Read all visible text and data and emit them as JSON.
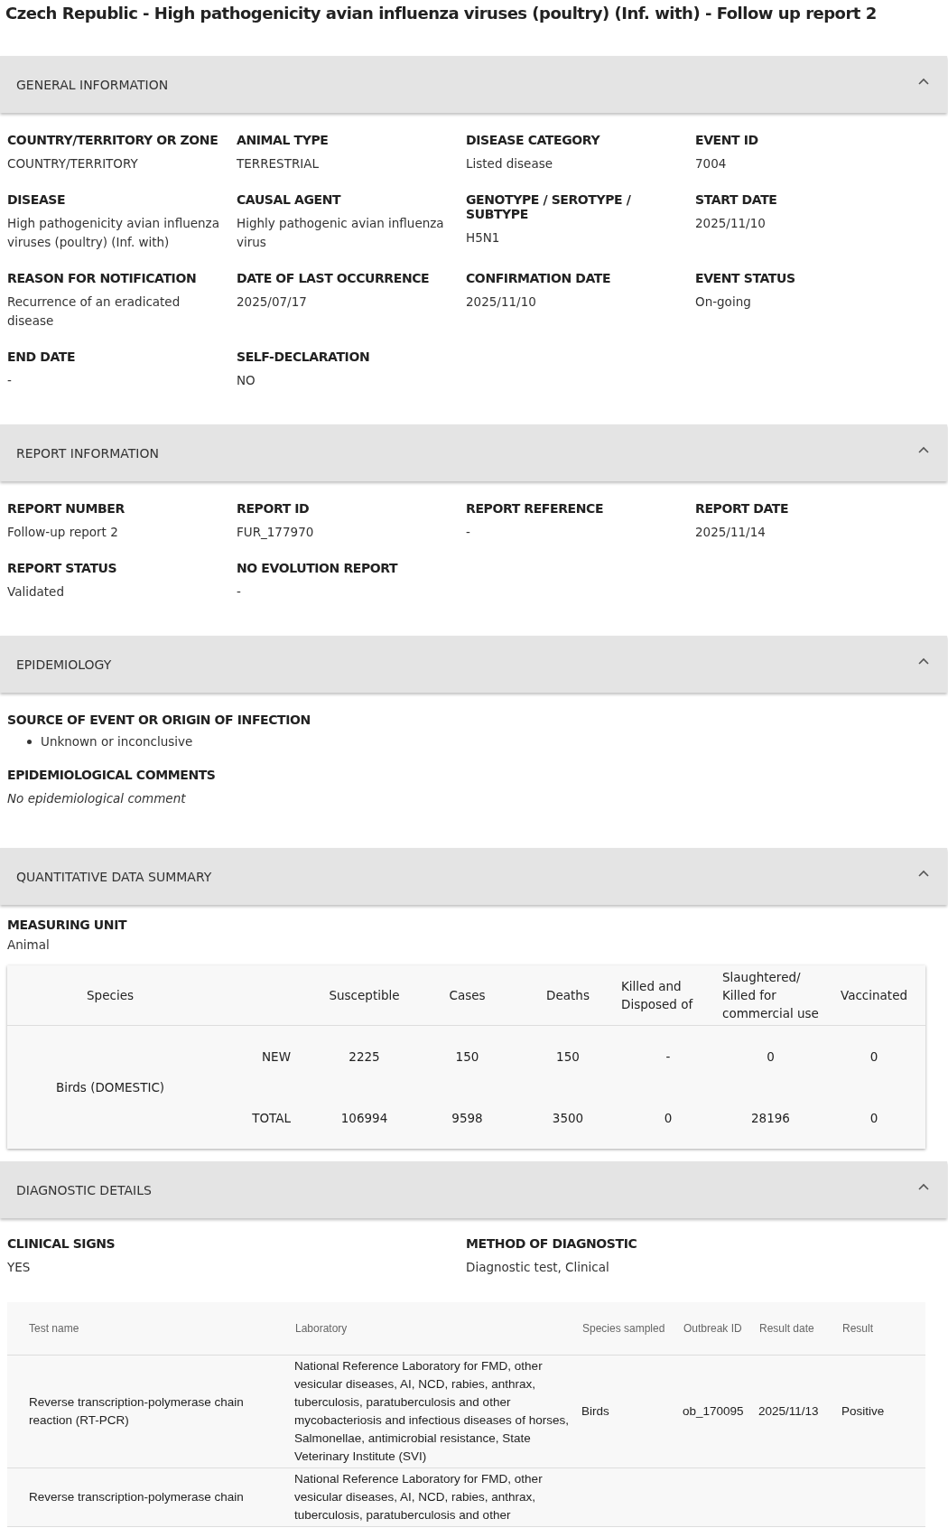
{
  "title": "Czech Republic - High pathogenicity avian influenza viruses (poultry) (Inf. with) - Follow up report 2",
  "general_information": {
    "title": "GENERAL INFORMATION",
    "expanded": true,
    "fields": [
      {
        "label": "COUNTRY/TERRITORY OR ZONE",
        "value": "COUNTRY/TERRITORY"
      },
      {
        "label": "ANIMAL TYPE",
        "value": "TERRESTRIAL"
      },
      {
        "label": "DISEASE CATEGORY",
        "value": "Listed disease"
      },
      {
        "label": "EVENT ID",
        "value": "7004"
      },
      {
        "label": "DISEASE",
        "value": "High pathogenicity avian influenza viruses (poultry) (Inf. with)"
      },
      {
        "label": "CAUSAL AGENT",
        "value": "Highly pathogenic avian influenza virus"
      },
      {
        "label": "GENOTYPE / SEROTYPE / SUBTYPE",
        "value": "H5N1"
      },
      {
        "label": "START DATE",
        "value": "2025/11/10"
      },
      {
        "label": "REASON FOR NOTIFICATION",
        "value": "Recurrence of an eradicated disease"
      },
      {
        "label": "DATE OF LAST OCCURRENCE",
        "value": "2025/07/17"
      },
      {
        "label": "CONFIRMATION DATE",
        "value": "2025/11/10"
      },
      {
        "label": "EVENT STATUS",
        "value": "On-going"
      },
      {
        "label": "END DATE",
        "value": "-"
      },
      {
        "label": "SELF-DECLARATION",
        "value": "NO"
      }
    ]
  },
  "report_information": {
    "title": "REPORT INFORMATION",
    "expanded": true,
    "fields": [
      {
        "label": "REPORT NUMBER",
        "value": "Follow-up report 2"
      },
      {
        "label": "REPORT ID",
        "value": "FUR_177970"
      },
      {
        "label": "REPORT REFERENCE",
        "value": "-"
      },
      {
        "label": "REPORT DATE",
        "value": "2025/11/14"
      },
      {
        "label": "REPORT STATUS",
        "value": "Validated"
      },
      {
        "label": "NO EVOLUTION REPORT",
        "value": "-"
      }
    ]
  },
  "epidemiology": {
    "title": "EPIDEMIOLOGY",
    "expanded": true,
    "source_label": "SOURCE OF EVENT OR ORIGIN OF INFECTION",
    "sources": [
      "Unknown or inconclusive"
    ],
    "comments_label": "EPIDEMIOLOGICAL COMMENTS",
    "comments": "No epidemiological comment"
  },
  "quantitative_data_summary": {
    "title": "QUANTITATIVE DATA SUMMARY",
    "expanded": true,
    "unit_label": "MEASURING UNIT",
    "unit": "Animal",
    "columns": [
      "Species",
      "Susceptible",
      "Cases",
      "Deaths",
      "Killed and Disposed of",
      "Slaughtered/ Killed for commercial use",
      "Vaccinated"
    ],
    "species": "Birds (DOMESTIC)",
    "rows": [
      {
        "type": "NEW",
        "values": [
          "2225",
          "150",
          "150",
          "-",
          "0",
          "0"
        ]
      },
      {
        "type": "TOTAL",
        "values": [
          "106994",
          "9598",
          "3500",
          "0",
          "28196",
          "0"
        ]
      }
    ]
  },
  "diagnostic_details": {
    "title": "DIAGNOSTIC DETAILS",
    "expanded": true,
    "fields": [
      {
        "label": "CLINICAL SIGNS",
        "value": "YES"
      },
      {
        "label": "METHOD OF DIAGNOSTIC",
        "value": "Diagnostic test, Clinical"
      }
    ],
    "columns": [
      "Test name",
      "Laboratory",
      "Species sampled",
      "Outbreak ID",
      "Result date",
      "Result"
    ],
    "rows": [
      {
        "cells": [
          "Reverse transcription-polymerase chain reaction (RT-PCR)",
          "National Reference Laboratory for FMD, other vesicular diseases, AI, NCD, rabies, anthrax, tuberculosis, paratuberculosis and other mycobacteriosis and infectious diseases of horses, Salmonellae, antimicrobial resistance, State Veterinary Institute (SVI)",
          "Birds",
          "ob_170095",
          "2025/11/13",
          "Positive"
        ]
      },
      {
        "cells": [
          "Reverse transcription-polymerase chain",
          "National Reference Laboratory for FMD, other vesicular diseases, AI, NCD, rabies, anthrax, tuberculosis, paratuberculosis and other",
          "",
          "",
          "",
          ""
        ]
      }
    ]
  }
}
